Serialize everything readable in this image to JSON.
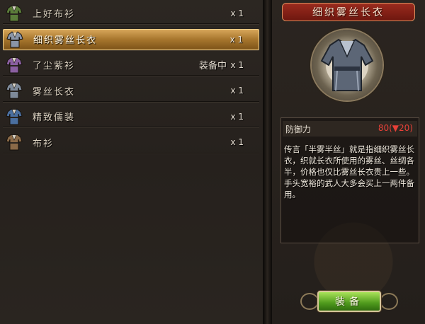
{
  "items": [
    {
      "name": "上好布衫",
      "status": "",
      "qty": "x 1",
      "icon": "green-robe-icon",
      "color": "#5b7d3a"
    },
    {
      "name": "细织雾丝长衣",
      "status": "",
      "qty": "x 1",
      "icon": "silver-robe-icon",
      "color": "#8a95a8",
      "selected": true
    },
    {
      "name": "了尘紫衫",
      "status": "装备中",
      "qty": "x 1",
      "icon": "purple-robe-icon",
      "color": "#8a5fa0"
    },
    {
      "name": "雾丝长衣",
      "status": "",
      "qty": "x 1",
      "icon": "gray-robe-icon",
      "color": "#7e8a9a"
    },
    {
      "name": "精致儒装",
      "status": "",
      "qty": "x 1",
      "icon": "blue-robe-icon",
      "color": "#4a6fa0"
    },
    {
      "name": "布衫",
      "status": "",
      "qty": "x 1",
      "icon": "brown-robe-icon",
      "color": "#8a6a48"
    }
  ],
  "detail": {
    "title": "细织雾丝长衣",
    "stat_label": "防御力",
    "stat_value": "80(▼20)",
    "description": "传言「半雾半丝」就是指细织雾丝长衣，织就长衣所使用的雾丝、丝绸各半，价格也仅比雾丝长衣贵上一些。手头宽裕的武人大多会买上一两件备用。",
    "equip_label": "装备"
  }
}
